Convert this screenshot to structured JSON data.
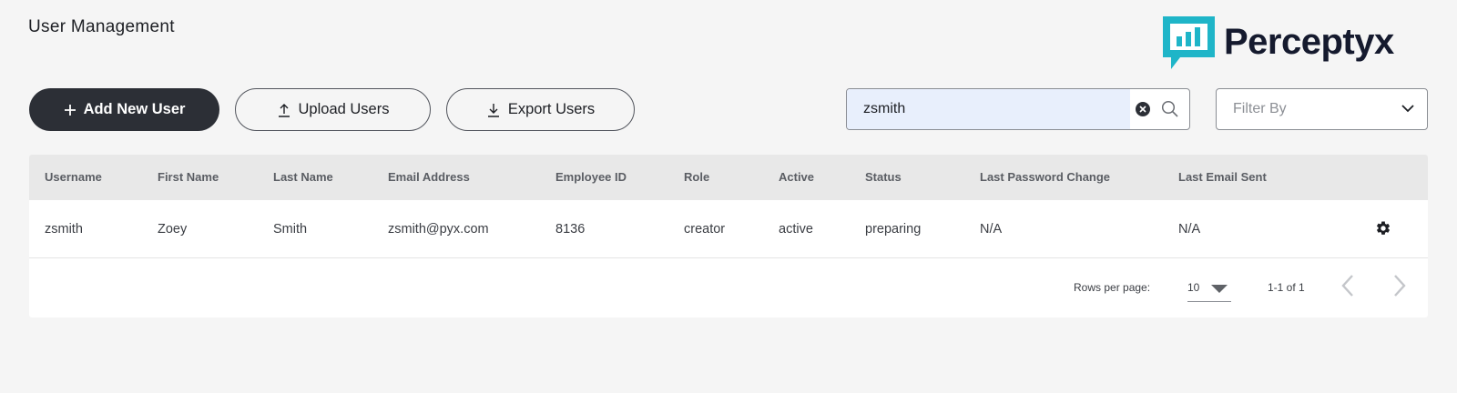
{
  "header": {
    "title": "User Management",
    "logo_text": "Perceptyx",
    "logo_icon": "chat-bar-chart-icon",
    "brand_colors": {
      "teal": "#1fb5c8",
      "dark": "#151a2e"
    }
  },
  "toolbar": {
    "add_label": "Add New User",
    "upload_label": "Upload Users",
    "export_label": "Export Users",
    "primary_color": "#2c2f36"
  },
  "search": {
    "value": "zsmith",
    "placeholder": ""
  },
  "filter": {
    "label": "Filter By"
  },
  "table": {
    "columns": [
      "Username",
      "First Name",
      "Last Name",
      "Email Address",
      "Employee ID",
      "Role",
      "Active",
      "Status",
      "Last Password Change",
      "Last Email Sent"
    ],
    "rows": [
      {
        "username": "zsmith",
        "first_name": "Zoey",
        "last_name": "Smith",
        "email": "zsmith@pyx.com",
        "employee_id": "8136",
        "role": "creator",
        "active": "active",
        "status": "preparing",
        "last_password_change": "N/A",
        "last_email_sent": "N/A"
      }
    ]
  },
  "pagination": {
    "rows_per_page_label": "Rows per page:",
    "rows_per_page": "10",
    "range": "1-1 of 1"
  }
}
